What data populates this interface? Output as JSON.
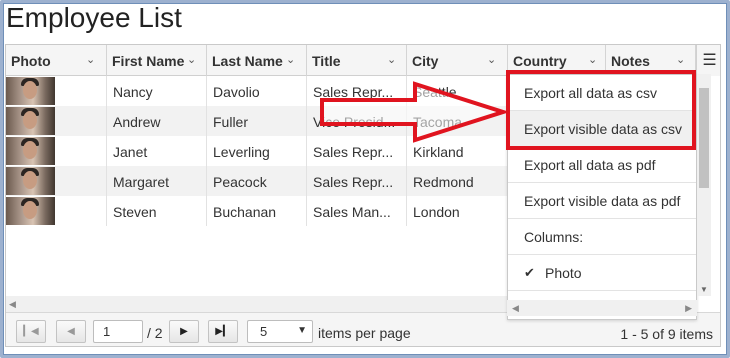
{
  "page": {
    "title": "Employee List"
  },
  "grid": {
    "columns": [
      "Photo",
      "First Name",
      "Last Name",
      "Title",
      "City",
      "Country",
      "Notes"
    ],
    "menu_icon": "hamburger-menu-icon",
    "rows": [
      {
        "first": "Nancy",
        "last": "Davolio",
        "title": "Sales Repr...",
        "city": "Seattle"
      },
      {
        "first": "Andrew",
        "last": "Fuller",
        "title": "Vice Presid...",
        "city": "Tacoma"
      },
      {
        "first": "Janet",
        "last": "Leverling",
        "title": "Sales Repr...",
        "city": "Kirkland"
      },
      {
        "first": "Margaret",
        "last": "Peacock",
        "title": "Sales Repr...",
        "city": "Redmond"
      },
      {
        "first": "Steven",
        "last": "Buchanan",
        "title": "Sales Man...",
        "city": "London"
      }
    ]
  },
  "pager": {
    "page": "1",
    "of": "/ 2",
    "page_size": "5",
    "items_per_page": "items per page",
    "info": "1 - 5 of 9 items"
  },
  "menu": {
    "items": [
      "Export all data as csv",
      "Export visible data as csv",
      "Export all data as pdf",
      "Export visible data as pdf",
      "Columns:",
      "Photo"
    ]
  },
  "colors": {
    "highlight": "#e0141f",
    "header_bg": "#f5f5f5",
    "row_alt": "#f2f2f2"
  }
}
